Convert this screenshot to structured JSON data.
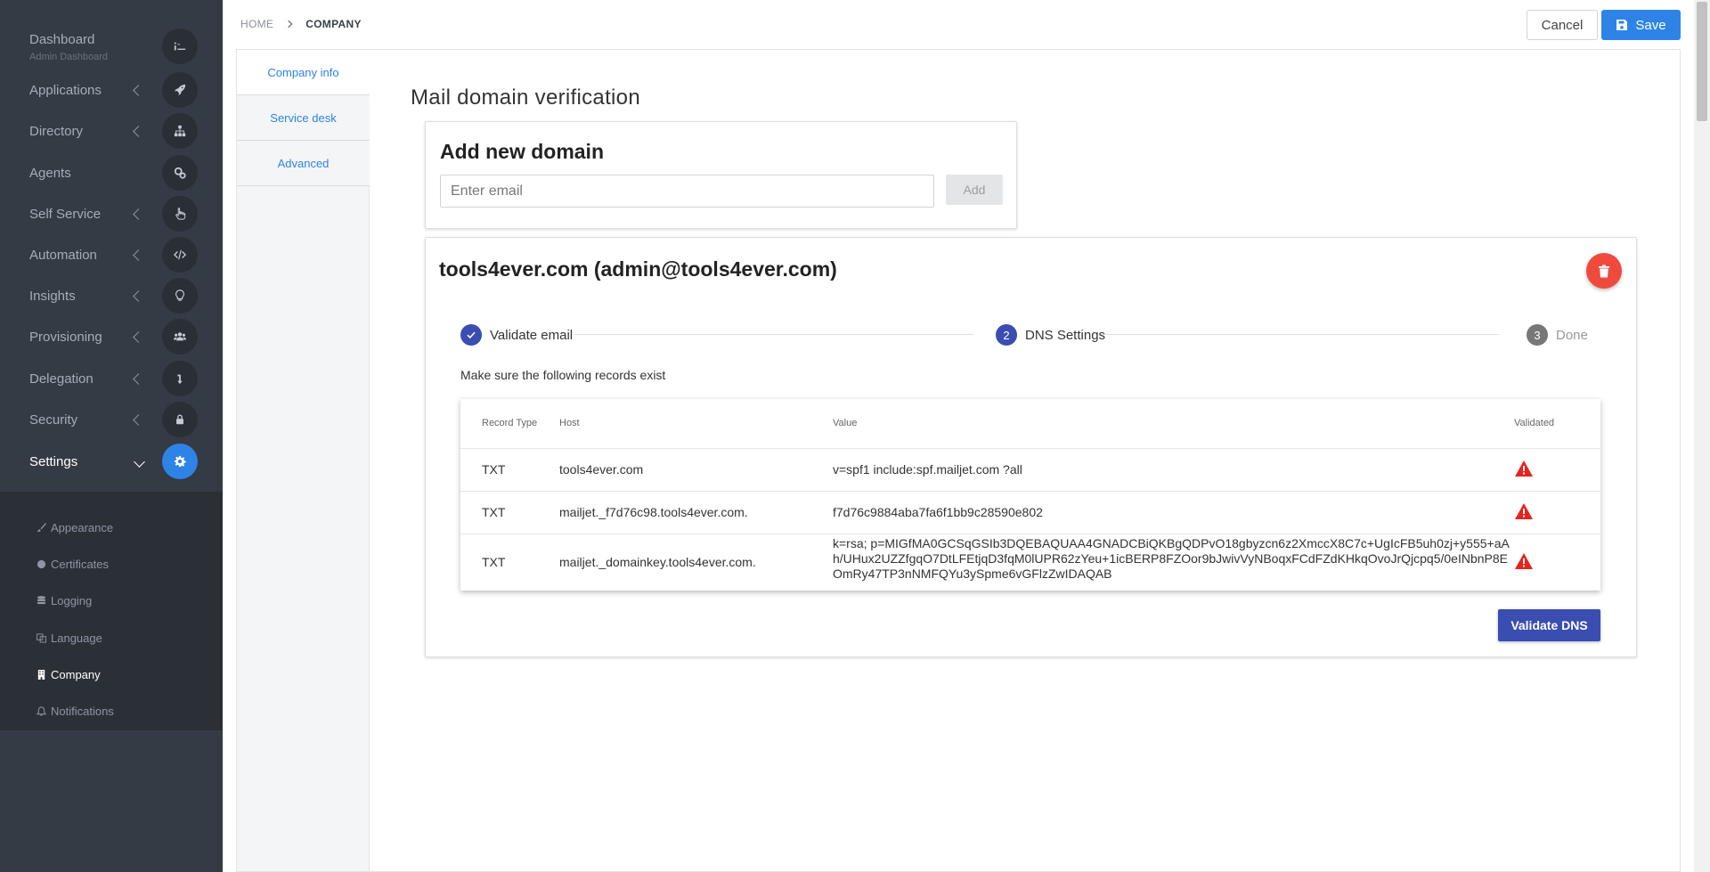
{
  "sidebar": {
    "items": [
      {
        "label": "Dashboard",
        "sub": "Admin Dashboard",
        "icon": "dashboard-icon"
      },
      {
        "label": "Applications",
        "icon": "rocket-icon"
      },
      {
        "label": "Directory",
        "icon": "sitemap-icon"
      },
      {
        "label": "Agents",
        "icon": "cogs-icon"
      },
      {
        "label": "Self Service",
        "icon": "hand-pointer-icon"
      },
      {
        "label": "Automation",
        "icon": "code-icon"
      },
      {
        "label": "Insights",
        "icon": "lightbulb-icon"
      },
      {
        "label": "Provisioning",
        "icon": "users-icon"
      },
      {
        "label": "Delegation",
        "icon": "level-down-icon"
      },
      {
        "label": "Security",
        "icon": "lock-icon"
      },
      {
        "label": "Settings",
        "icon": "gear-icon"
      }
    ],
    "submenu": [
      {
        "label": "Appearance",
        "icon": "brush-icon"
      },
      {
        "label": "Certificates",
        "icon": "certificate-icon"
      },
      {
        "label": "Logging",
        "icon": "database-icon"
      },
      {
        "label": "Language",
        "icon": "language-icon"
      },
      {
        "label": "Company",
        "icon": "building-icon"
      },
      {
        "label": "Notifications",
        "icon": "bell-icon"
      }
    ]
  },
  "breadcrumb": {
    "home": "HOME",
    "current": "COMPANY"
  },
  "toolbar": {
    "cancel_label": "Cancel",
    "save_label": "Save"
  },
  "tabs": [
    {
      "label": "Company info"
    },
    {
      "label": "Service desk"
    },
    {
      "label": "Advanced"
    }
  ],
  "section": {
    "title": "Mail domain verification"
  },
  "add_domain": {
    "title": "Add new domain",
    "placeholder": "Enter email",
    "button": "Add"
  },
  "domain": {
    "title": "tools4ever.com (admin@tools4ever.com)",
    "steps": [
      {
        "number": "1",
        "label": "Validate email",
        "state": "done"
      },
      {
        "number": "2",
        "label": "DNS Settings",
        "state": "current"
      },
      {
        "number": "3",
        "label": "Done",
        "state": "pending"
      }
    ],
    "note": "Make sure the following records exist",
    "table": {
      "headers": {
        "type": "Record Type",
        "host": "Host",
        "value": "Value",
        "validated": "Validated"
      },
      "rows": [
        {
          "type": "TXT",
          "host": "tools4ever.com",
          "value": "v=spf1 include:spf.mailjet.com ?all",
          "validated": false
        },
        {
          "type": "TXT",
          "host": "mailjet._f7d76c98.tools4ever.com.",
          "value": "f7d76c9884aba7fa6f1bb9c28590e802",
          "validated": false
        },
        {
          "type": "TXT",
          "host": "mailjet._domainkey.tools4ever.com.",
          "value_lines": [
            "k=rsa; p=MIGfMA0GCSqGSIb3DQEBAQUAA4GNADCBiQKBgQDPvO18gbyzcn6z2XmccX8C7c+UgIcFB5uh0zj+y555+aA",
            "h/UHux2UZZfgqO7DtLFEtjqD3fqM0lUPR62zYeu+1icBERP8FZOor9bJwivVyNBoqxFCdFZdKHkqOvoJrQjcpq5/0eINbnP8E",
            "OmRy47TP3nNMFQYu3ySpme6vGFlzZwIDAQAB"
          ],
          "validated": false
        }
      ]
    },
    "validate_button": "Validate DNS"
  },
  "colors": {
    "sidebar_bg": "#353b44",
    "accent": "#2d84e6",
    "primary": "#3a4db0",
    "danger": "#f04a3e",
    "warning": "#e8231f"
  }
}
